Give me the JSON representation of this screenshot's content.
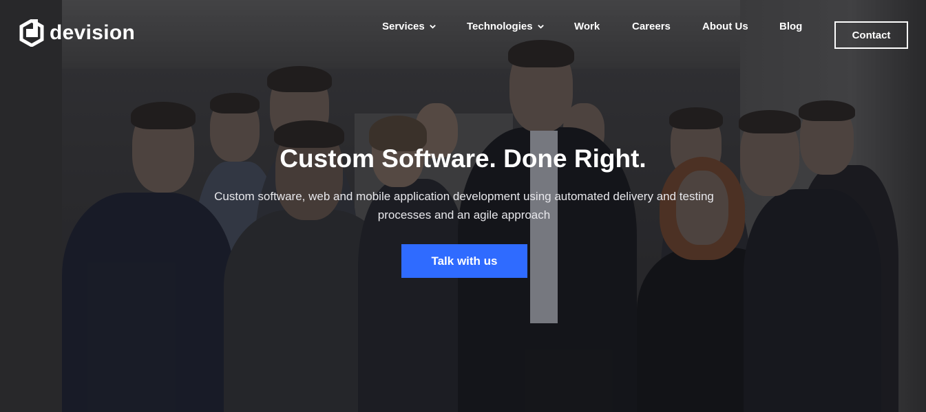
{
  "brand": {
    "name": "devision"
  },
  "nav": {
    "services": "Services",
    "technologies": "Technologies",
    "work": "Work",
    "careers": "Careers",
    "about": "About Us",
    "blog": "Blog",
    "contact": "Contact"
  },
  "hero": {
    "title": "Custom Software. Done Right.",
    "subtitle": "Custom software, web and mobile application development using automated delivery and testing processes and an agile approach",
    "cta": "Talk with us"
  },
  "colors": {
    "accent": "#2f6bff",
    "text": "#ffffff"
  },
  "icons": {
    "logo": "devision-logo-icon",
    "dropdown": "chevron-down-icon"
  }
}
